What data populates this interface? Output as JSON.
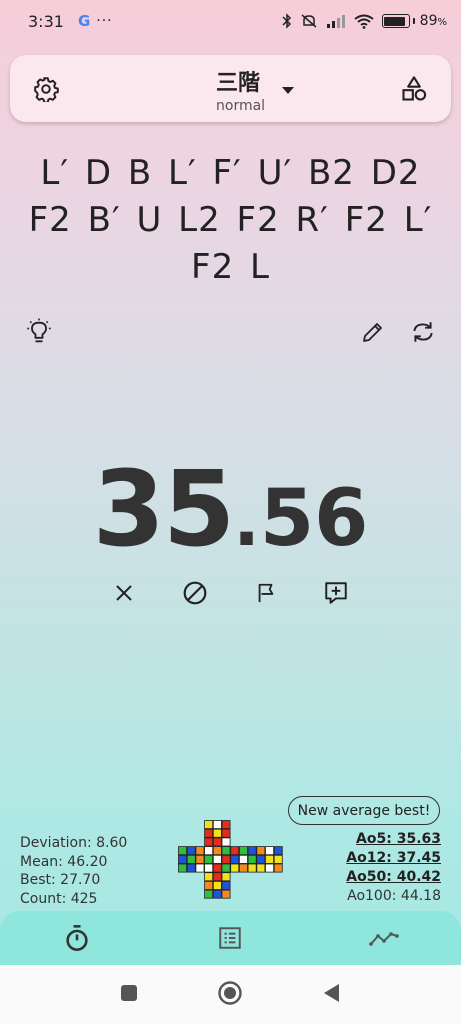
{
  "status": {
    "time": "3:31",
    "google": "G",
    "more": "···",
    "battery": "89",
    "battery_unit": "%"
  },
  "header": {
    "puzzle": "三階",
    "mode": "normal"
  },
  "scramble": "L′ D B L′ F′ U′ B2 D2 F2 B′ U L2 F2 R′ F2 L′ F2 L",
  "timer": {
    "integer": "35",
    "dot": ".",
    "fraction": "56"
  },
  "badge": "New average best!",
  "stats_left": {
    "deviation": "Deviation: 8.60",
    "mean": "Mean: 46.20",
    "best": "Best: 27.70",
    "count": "Count: 425"
  },
  "stats_right": {
    "ao5": "Ao5: 35.63",
    "ao12": "Ao12: 37.45",
    "ao50": "Ao50: 40.42",
    "ao100": "Ao100: 44.18"
  },
  "colors": {
    "accent": "#8ee6dc",
    "top_card": "#fbe7ee",
    "timer_text": "#333333"
  },
  "icons": {
    "settings": "gear-icon",
    "puzzle_type": "shapes-icon",
    "hint": "lightbulb-icon",
    "edit": "pencil-icon",
    "refresh": "refresh-icon",
    "dnf": "close-icon",
    "plus_two": "block-icon",
    "flag": "flag-icon",
    "comment": "add-comment-icon",
    "nav_timer": "stopwatch-icon",
    "nav_list": "list-icon",
    "nav_stats": "trend-icon"
  },
  "cube_net": [
    [
      null,
      null,
      null,
      "Y",
      "W",
      "R",
      null,
      null,
      null,
      null,
      null,
      null
    ],
    [
      null,
      null,
      null,
      "R",
      "Y",
      "R",
      null,
      null,
      null,
      null,
      null,
      null
    ],
    [
      null,
      null,
      null,
      "R",
      "R",
      "W",
      null,
      null,
      null,
      null,
      null,
      null
    ],
    [
      "G",
      "B",
      "O",
      "W",
      "O",
      "G",
      "R",
      "G",
      "B",
      "O",
      "W",
      "B"
    ],
    [
      "B",
      "G",
      "O",
      "G",
      "W",
      "R",
      "B",
      "W",
      "G",
      "B",
      "Y",
      "Y"
    ],
    [
      "G",
      "B",
      "W",
      "W",
      "R",
      "G",
      "Y",
      "O",
      "Y",
      "Y",
      "W",
      "O"
    ],
    [
      null,
      null,
      null,
      "Y",
      "R",
      "Y",
      null,
      null,
      null,
      null,
      null,
      null
    ],
    [
      null,
      null,
      null,
      "O",
      "Y",
      "B",
      null,
      null,
      null,
      null,
      null,
      null
    ],
    [
      null,
      null,
      null,
      "G",
      "B",
      "O",
      null,
      null,
      null,
      null,
      null,
      null
    ]
  ]
}
